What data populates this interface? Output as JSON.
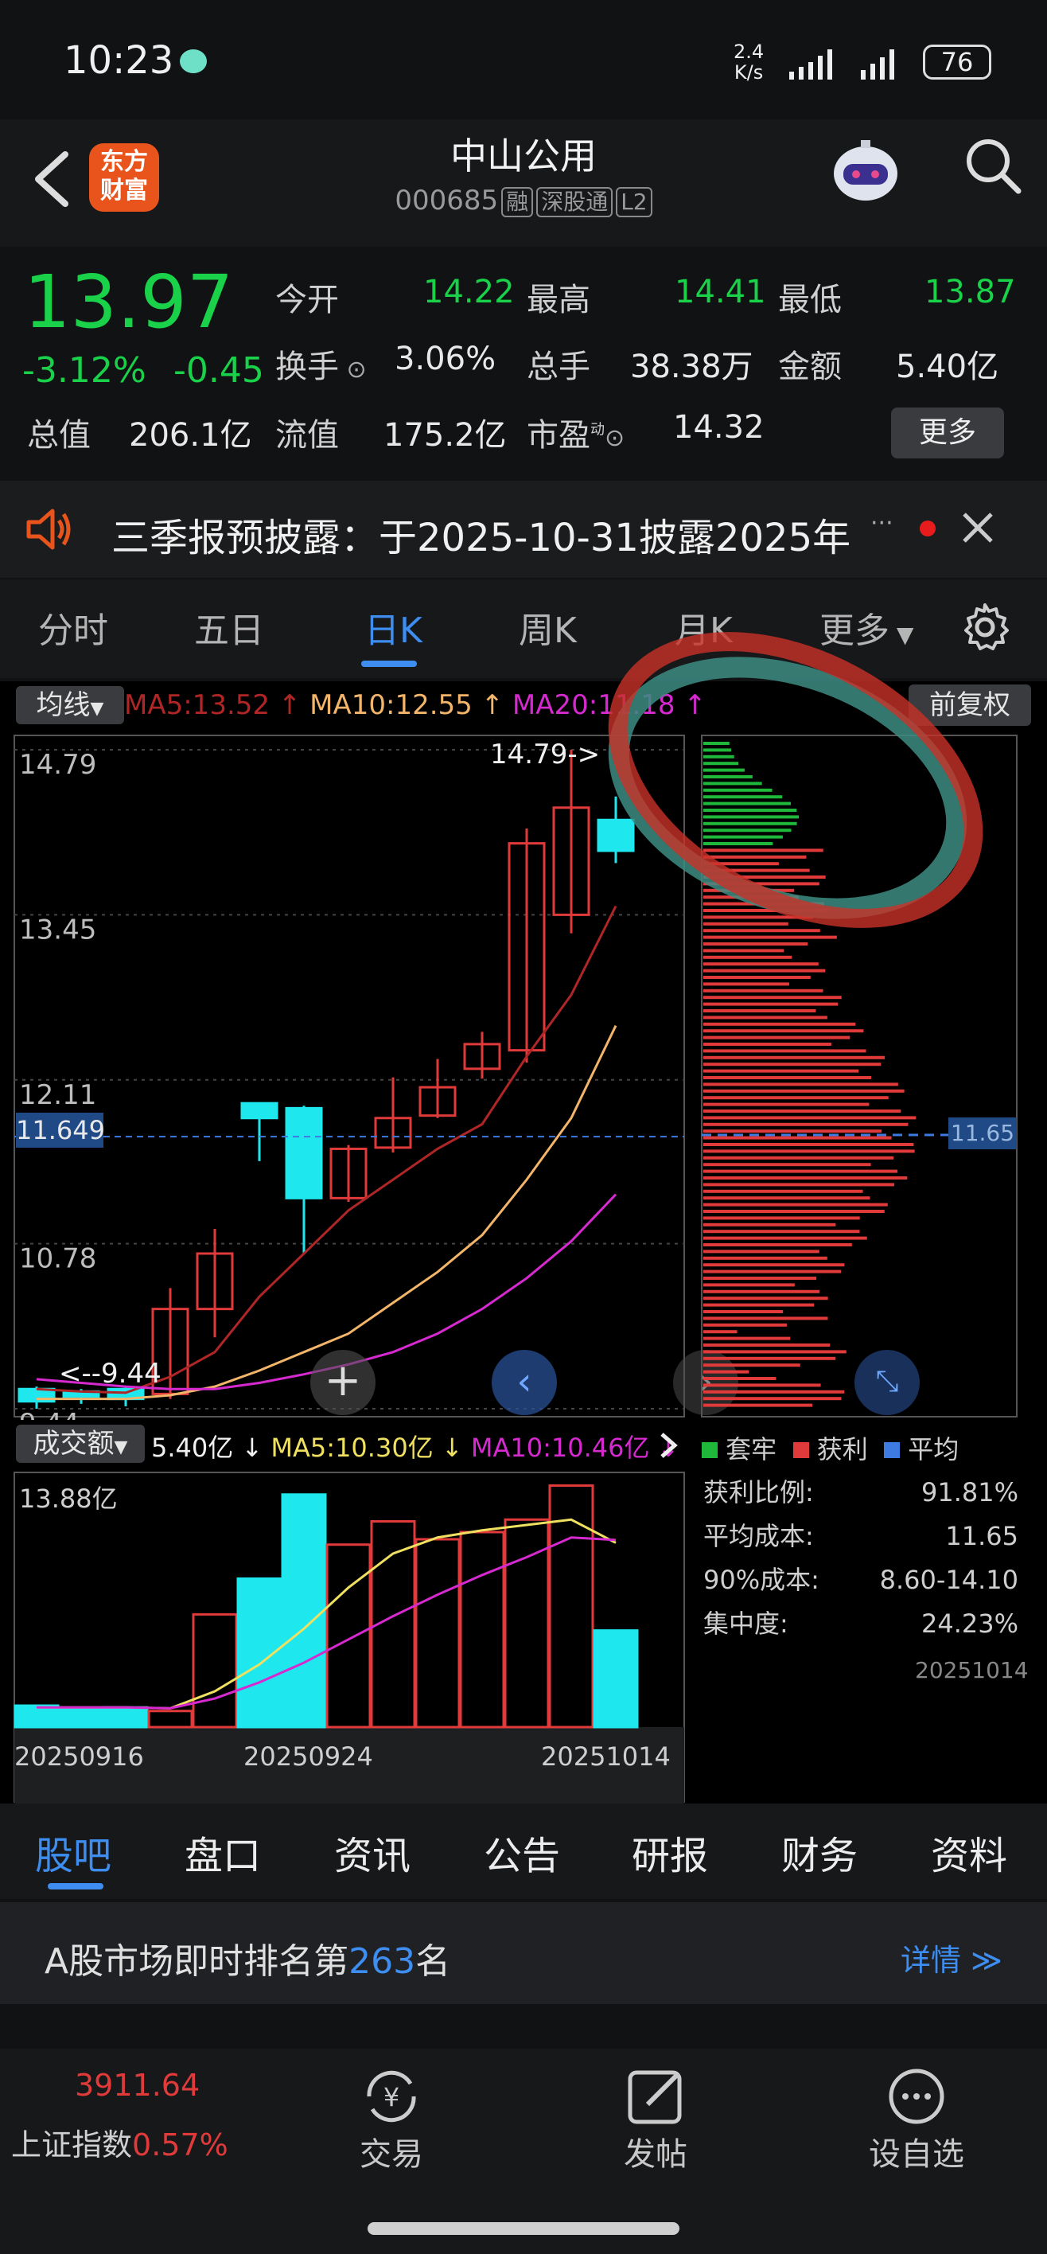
{
  "status": {
    "time": "10:23",
    "speed": "2.4\nK/s",
    "battery": "76"
  },
  "header": {
    "logo_line1": "东方",
    "logo_line2": "财富",
    "name": "中山公用",
    "code": "000685",
    "tags": [
      "融",
      "深股通",
      "L2"
    ]
  },
  "quote": {
    "price": "13.97",
    "pct": "-3.12%",
    "change": "-0.45",
    "open_label": "今开",
    "open": "14.22",
    "high_label": "最高",
    "high": "14.41",
    "low_label": "最低",
    "low": "13.87",
    "turnover_label": "换手",
    "turnover": "3.06%",
    "volume_label": "总手",
    "volume": "38.38万",
    "amount_label": "金额",
    "amount": "5.40亿",
    "mcap_label": "总值",
    "mcap": "206.1亿",
    "float_label": "流值",
    "float": "175.2亿",
    "pe_label": "市盈",
    "pe_sup": "动",
    "pe": "14.32",
    "more": "更多"
  },
  "notice": {
    "text": "三季报预披露：于2025-10-31披露2025年",
    "ellipsis": "···"
  },
  "period_tabs": [
    "分时",
    "五日",
    "日K",
    "周K",
    "月K",
    "更多"
  ],
  "ma_bar": {
    "selector": "均线",
    "ma5": "MA5:13.52",
    "ma10": "MA10:12.55",
    "ma20": "MA20:11.18",
    "adjust": "前复权"
  },
  "kline": {
    "y_labels": [
      "14.79",
      "13.45",
      "12.11",
      "10.78",
      "9.44"
    ],
    "cursor_price": "11.649",
    "high_marker": "14.79->",
    "low_marker": "<--9.44",
    "colors": {
      "up": "#e03a3a",
      "down": "#1ee8ee",
      "ma5": "#b02626",
      "ma10": "#f2b56a",
      "ma20": "#d629d0"
    }
  },
  "chips": {
    "cursor_price": "11.65",
    "legend": [
      "套牢",
      "获利",
      "平均"
    ],
    "stats": [
      [
        "获利比例:",
        "91.81%"
      ],
      [
        "平均成本:",
        "11.65"
      ],
      [
        "90%成本:",
        "8.60-14.10"
      ],
      [
        "集中度:",
        "24.23%"
      ]
    ],
    "date": "20251014"
  },
  "volume_bar": {
    "selector": "成交额",
    "value": "5.40亿",
    "ma5": "MA5:10.30亿",
    "ma10": "MA10:10.46亿",
    "max": "13.88亿",
    "dates": [
      "20250916",
      "20250924",
      "20251014"
    ]
  },
  "bottom_tabs": [
    "股吧",
    "盘口",
    "资讯",
    "公告",
    "研报",
    "财务",
    "资料"
  ],
  "rank": {
    "prefix": "A股市场即时排名第",
    "rank": "263",
    "suffix": "名",
    "detail": "详情"
  },
  "nav": {
    "index_value": "3911.64",
    "index_name": "上证指数",
    "index_pct": "0.57%",
    "items": [
      "交易",
      "发帖",
      "设自选"
    ]
  },
  "chart_data": {
    "type": "candlestick",
    "ylim": [
      9.44,
      14.79
    ],
    "candles": [
      {
        "o": 9.6,
        "c": 9.5,
        "h": 9.62,
        "l": 9.44
      },
      {
        "o": 9.58,
        "c": 9.54,
        "h": 9.6,
        "l": 9.48
      },
      {
        "o": 9.6,
        "c": 9.52,
        "h": 9.62,
        "l": 9.46
      },
      {
        "o": 9.56,
        "c": 10.25,
        "h": 10.42,
        "l": 9.52
      },
      {
        "o": 10.25,
        "c": 10.7,
        "h": 10.9,
        "l": 10.02
      },
      {
        "o": 11.92,
        "c": 11.8,
        "h": 11.92,
        "l": 11.45
      },
      {
        "o": 11.88,
        "c": 11.15,
        "h": 11.9,
        "l": 10.7
      },
      {
        "o": 11.15,
        "c": 11.55,
        "h": 11.58,
        "l": 11.12
      },
      {
        "o": 11.56,
        "c": 11.8,
        "h": 12.13,
        "l": 11.52
      },
      {
        "o": 11.82,
        "c": 12.05,
        "h": 12.28,
        "l": 11.8
      },
      {
        "o": 12.2,
        "c": 12.4,
        "h": 12.5,
        "l": 12.12
      },
      {
        "o": 12.35,
        "c": 14.03,
        "h": 14.15,
        "l": 12.25
      },
      {
        "o": 13.45,
        "c": 14.32,
        "h": 14.79,
        "l": 13.3
      },
      {
        "o": 14.22,
        "c": 13.97,
        "h": 14.41,
        "l": 13.87
      }
    ],
    "ma5": [
      9.6,
      9.58,
      9.57,
      9.7,
      9.9,
      10.35,
      10.7,
      11.05,
      11.3,
      11.55,
      11.75,
      12.3,
      12.8,
      13.52
    ],
    "ma10": [
      9.52,
      9.52,
      9.52,
      9.55,
      9.62,
      9.75,
      9.9,
      10.05,
      10.3,
      10.55,
      10.85,
      11.3,
      11.8,
      12.55
    ],
    "ma20": [
      9.68,
      9.65,
      9.62,
      9.6,
      9.6,
      9.65,
      9.72,
      9.8,
      9.9,
      10.05,
      10.25,
      10.5,
      10.8,
      11.18
    ],
    "volume": [
      1.2,
      1.0,
      1.1,
      0.9,
      6.3,
      8.3,
      13.0,
      10.2,
      11.5,
      10.5,
      10.9,
      11.6,
      13.5,
      5.4
    ],
    "vol_ma5": [
      1.1,
      1.1,
      1.1,
      1.05,
      2.0,
      3.5,
      5.5,
      7.8,
      9.7,
      10.6,
      11.0,
      11.3,
      11.6,
      10.3
    ],
    "vol_ma10": [
      1.1,
      1.1,
      1.1,
      1.05,
      1.6,
      2.5,
      3.6,
      4.9,
      6.2,
      7.4,
      8.5,
      9.5,
      10.6,
      10.46
    ]
  }
}
